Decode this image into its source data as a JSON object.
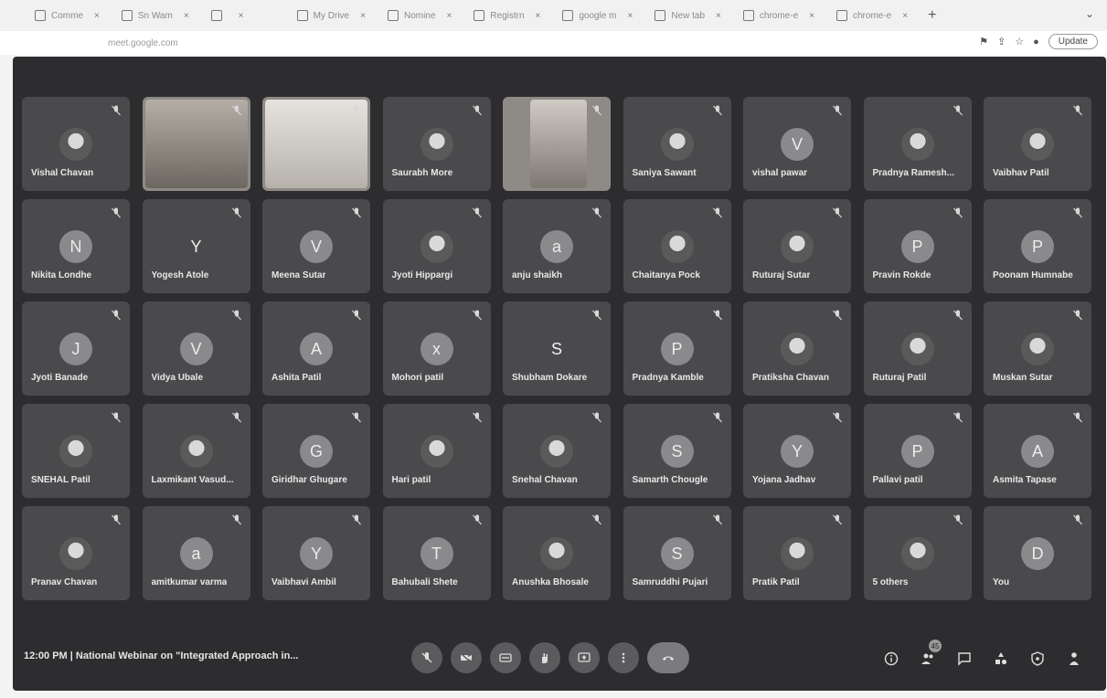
{
  "browser": {
    "tabs": [
      {
        "label": "Comme"
      },
      {
        "label": "Sn Wam"
      },
      {
        "label": ""
      },
      {
        "label": "My Drive"
      },
      {
        "label": "Nomine"
      },
      {
        "label": "Registrn"
      },
      {
        "label": "google m"
      },
      {
        "label": "New tab"
      },
      {
        "label": "chrome-e"
      },
      {
        "label": "chrome-e"
      }
    ],
    "url": "meet.google.com",
    "update_label": "Update"
  },
  "participants": [
    {
      "name": "Vishal Chavan",
      "avatar": "",
      "type": "photo"
    },
    {
      "name": "",
      "avatar": "",
      "type": "video"
    },
    {
      "name": "",
      "avatar": "",
      "type": "video-light"
    },
    {
      "name": "Saurabh More",
      "avatar": "",
      "type": "photo"
    },
    {
      "name": "",
      "avatar": "",
      "type": "video-narrow"
    },
    {
      "name": "Saniya Sawant",
      "avatar": "",
      "type": "photo"
    },
    {
      "name": "vishal pawar",
      "avatar": "V",
      "type": "letter"
    },
    {
      "name": "Pradnya Ramesh...",
      "avatar": "",
      "type": "photo"
    },
    {
      "name": "Vaibhav Patil",
      "avatar": "",
      "type": "photo"
    },
    {
      "name": "Nikita Londhe",
      "avatar": "N",
      "type": "letter"
    },
    {
      "name": "Yogesh Atole",
      "avatar": "Y",
      "type": "plain"
    },
    {
      "name": "Meena Sutar",
      "avatar": "V",
      "type": "letter"
    },
    {
      "name": "Jyoti Hippargi",
      "avatar": "",
      "type": "photo"
    },
    {
      "name": "anju shaikh",
      "avatar": "a",
      "type": "letter"
    },
    {
      "name": "Chaitanya Pock",
      "avatar": "",
      "type": "photo"
    },
    {
      "name": "Ruturaj Sutar",
      "avatar": "",
      "type": "photo"
    },
    {
      "name": "Pravin Rokde",
      "avatar": "P",
      "type": "letter"
    },
    {
      "name": "Poonam Humnabe",
      "avatar": "P",
      "type": "letter"
    },
    {
      "name": "Jyoti Banade",
      "avatar": "J",
      "type": "letter"
    },
    {
      "name": "Vidya Ubale",
      "avatar": "V",
      "type": "letter"
    },
    {
      "name": "Ashita Patil",
      "avatar": "A",
      "type": "letter"
    },
    {
      "name": "Mohori patil",
      "avatar": "x",
      "type": "letter"
    },
    {
      "name": "Shubham Dokare",
      "avatar": "S",
      "type": "plain"
    },
    {
      "name": "Pradnya Kamble",
      "avatar": "P",
      "type": "letter"
    },
    {
      "name": "Pratiksha Chavan",
      "avatar": "",
      "type": "photo"
    },
    {
      "name": "Ruturaj Patil",
      "avatar": "",
      "type": "photo"
    },
    {
      "name": "Muskan Sutar",
      "avatar": "",
      "type": "photo"
    },
    {
      "name": "SNEHAL Patil",
      "avatar": "",
      "type": "photo"
    },
    {
      "name": "Laxmikant Vasud...",
      "avatar": "",
      "type": "photo"
    },
    {
      "name": "Giridhar Ghugare",
      "avatar": "G",
      "type": "letter"
    },
    {
      "name": "Hari patil",
      "avatar": "",
      "type": "photo"
    },
    {
      "name": "Snehal Chavan",
      "avatar": "",
      "type": "photo"
    },
    {
      "name": "Samarth Chougle",
      "avatar": "S",
      "type": "letter"
    },
    {
      "name": "Yojana Jadhav",
      "avatar": "Y",
      "type": "letter"
    },
    {
      "name": "Pallavi patil",
      "avatar": "P",
      "type": "letter"
    },
    {
      "name": "Asmita Tapase",
      "avatar": "A",
      "type": "letter"
    },
    {
      "name": "Pranav Chavan",
      "avatar": "",
      "type": "photo"
    },
    {
      "name": "amitkumar varma",
      "avatar": "a",
      "type": "letter"
    },
    {
      "name": "Vaibhavi Ambil",
      "avatar": "Y",
      "type": "letter"
    },
    {
      "name": "Bahubali Shete",
      "avatar": "T",
      "type": "letter"
    },
    {
      "name": "Anushka Bhosale",
      "avatar": "",
      "type": "photo"
    },
    {
      "name": "Samruddhi Pujari",
      "avatar": "S",
      "type": "letter"
    },
    {
      "name": "Pratik Patil",
      "avatar": "",
      "type": "photo"
    },
    {
      "name": "5 others",
      "avatar": "",
      "type": "photo"
    },
    {
      "name": "You",
      "avatar": "D",
      "type": "letter"
    }
  ],
  "footer": {
    "time": "12:00 PM",
    "separator": "|",
    "meeting_title": "National Webinar on \"Integrated Approach in...",
    "people_count": "45"
  }
}
